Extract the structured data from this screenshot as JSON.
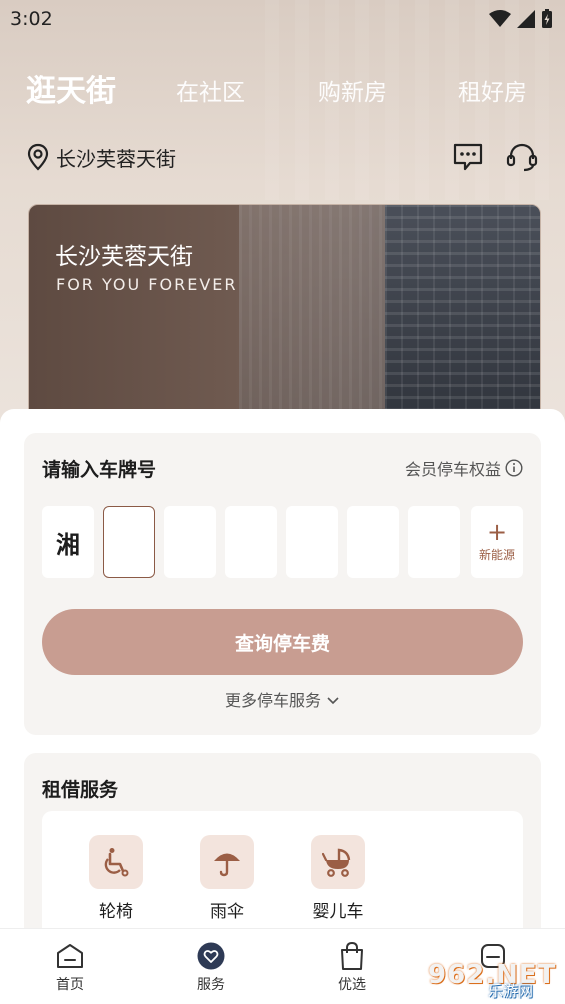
{
  "status_bar": {
    "time": "3:02"
  },
  "top_tabs": [
    {
      "label": "逛天街",
      "active": true
    },
    {
      "label": "在社区",
      "active": false
    },
    {
      "label": "购新房",
      "active": false
    },
    {
      "label": "租好房",
      "active": false
    }
  ],
  "location": {
    "name": "长沙芙蓉天街"
  },
  "banner": {
    "title": "长沙芙蓉天街",
    "subtitle": "FOR YOU FOREVER"
  },
  "parking": {
    "title": "请输入车牌号",
    "benefit_label": "会员停车权益",
    "province": "湘",
    "new_energy_plus": "+",
    "new_energy_label": "新能源",
    "query_button": "查询停车费",
    "more_services": "更多停车服务"
  },
  "rental": {
    "title": "租借服务",
    "items": [
      {
        "label": "轮椅",
        "icon": "wheelchair-icon"
      },
      {
        "label": "雨伞",
        "icon": "umbrella-icon"
      },
      {
        "label": "婴儿车",
        "icon": "stroller-icon"
      }
    ]
  },
  "bottom_nav": [
    {
      "label": "首页",
      "icon": "home-icon"
    },
    {
      "label": "服务",
      "icon": "service-heart-icon"
    },
    {
      "label": "优选",
      "icon": "shopping-bag-icon"
    },
    {
      "label": "",
      "icon": "profile-icon"
    }
  ],
  "watermark": {
    "text": "962.NET",
    "sub": "乐游网"
  },
  "colors": {
    "accent": "#c89d91",
    "accent_dark": "#9b5e45",
    "rental_icon_bg": "#f3e4dd",
    "nav_active": "#2e3a55"
  }
}
